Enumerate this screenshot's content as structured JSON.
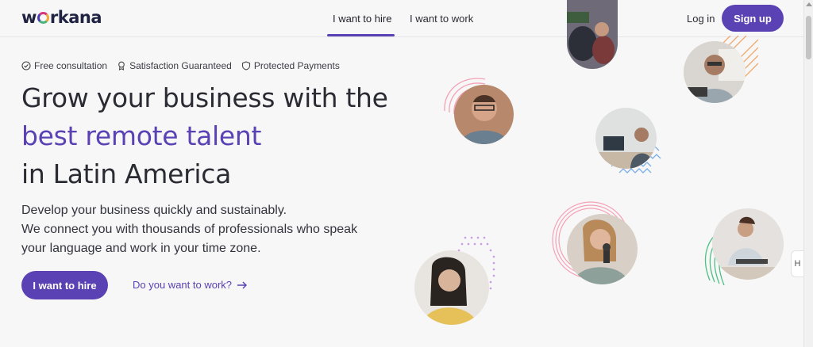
{
  "brand": {
    "logo_text_left": "w",
    "logo_text_right": "rkana"
  },
  "nav": {
    "tabs": [
      {
        "label": "I want to hire",
        "active": true
      },
      {
        "label": "I want to work",
        "active": false
      }
    ],
    "login_label": "Log in",
    "signup_label": "Sign up"
  },
  "guarantees": [
    {
      "icon": "check-circle-icon",
      "label": "Free consultation"
    },
    {
      "icon": "award-icon",
      "label": "Satisfaction Guaranteed"
    },
    {
      "icon": "shield-icon",
      "label": "Protected Payments"
    }
  ],
  "hero": {
    "line1": "Grow your business with the",
    "line2": "best remote talent",
    "line3": "in Latin America",
    "subtitle_line1": "Develop your business quickly and sustainably.",
    "subtitle_line2": "We connect you with thousands of professionals who speak",
    "subtitle_line3": "your language and work in your time zone.",
    "cta_label": "I want to hire",
    "secondary_link": "Do you want to work?"
  },
  "side_widget_label": "H",
  "colors": {
    "accent": "#5a42b5",
    "text": "#2b2b33",
    "background": "#f7f7f8"
  }
}
